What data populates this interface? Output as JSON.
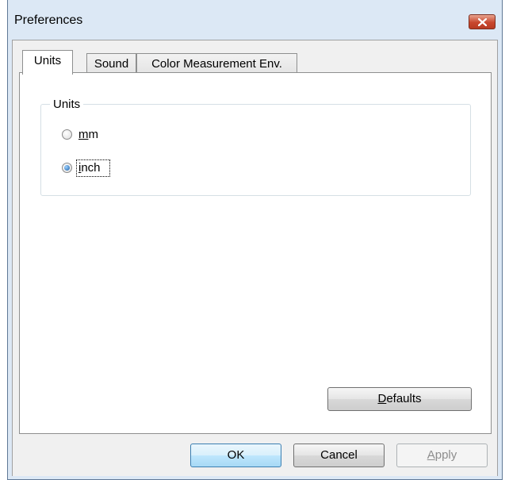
{
  "window": {
    "title": "Preferences",
    "close_icon": "close-icon"
  },
  "tabs": [
    {
      "label": "Units",
      "active": true
    },
    {
      "label": "Sound",
      "active": false
    },
    {
      "label": "Color Measurement Env.",
      "active": false
    }
  ],
  "units_group": {
    "label": "Units",
    "options": [
      {
        "label": "mm",
        "mnemonic": "m",
        "rest": "m",
        "checked": false
      },
      {
        "label": "inch",
        "mnemonic": "i",
        "rest": "nch",
        "checked": true
      }
    ]
  },
  "buttons": {
    "defaults": {
      "label": "Defaults",
      "mnemonic": "D",
      "rest": "efaults"
    },
    "ok": {
      "label": "OK"
    },
    "cancel": {
      "label": "Cancel"
    },
    "apply": {
      "label": "Apply",
      "mnemonic": "A",
      "rest": "pply",
      "disabled": true
    }
  },
  "colors": {
    "frame": "#dce8f5",
    "close": "#c8472e",
    "selected_radio": "#1b5fa8"
  }
}
